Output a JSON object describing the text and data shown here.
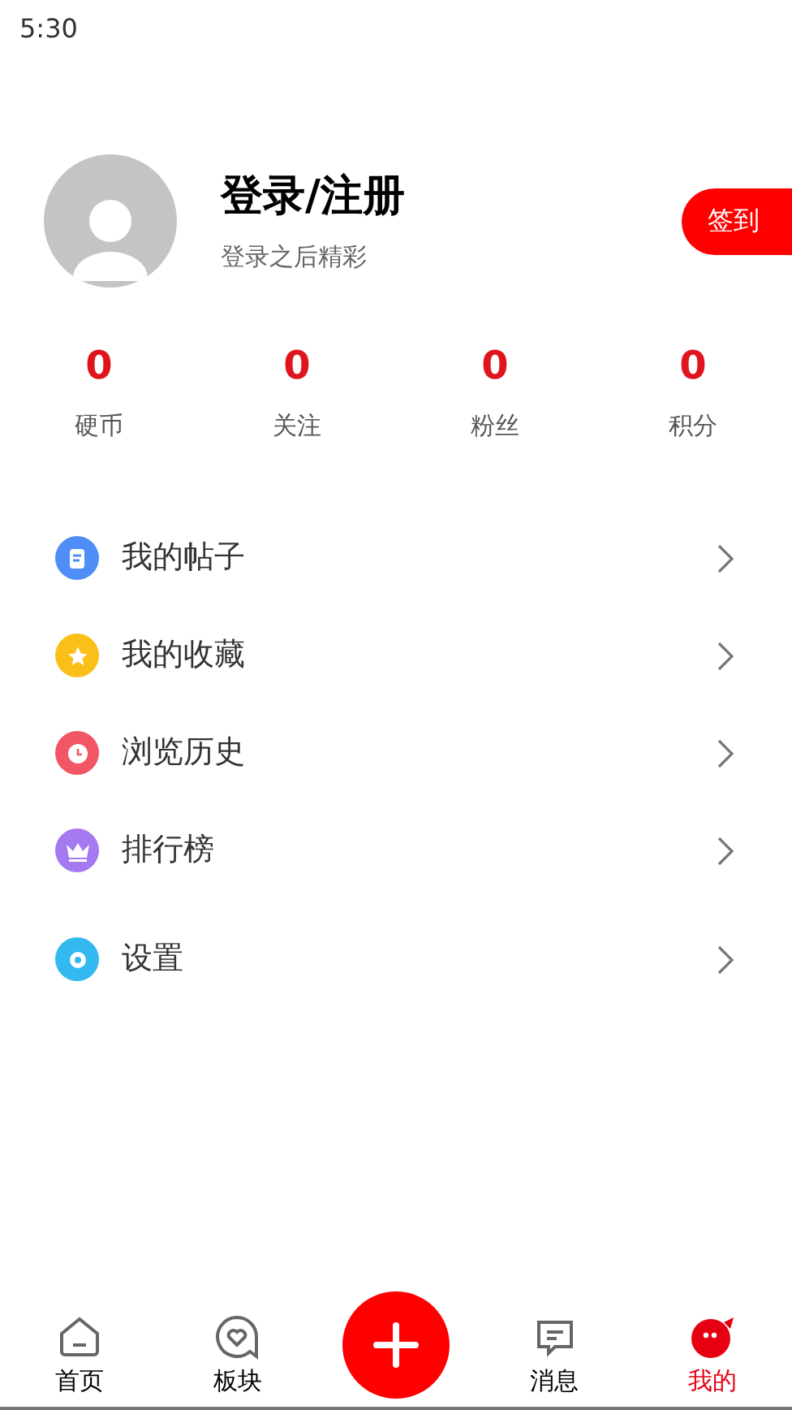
{
  "status_bar": {
    "time": "5:30"
  },
  "profile": {
    "name": "登录/注册",
    "subtitle": "登录之后精彩",
    "checkin_button": "签到"
  },
  "stats": [
    {
      "value": "0",
      "label": "硬币"
    },
    {
      "value": "0",
      "label": "关注"
    },
    {
      "value": "0",
      "label": "粉丝"
    },
    {
      "value": "0",
      "label": "积分"
    }
  ],
  "menu": [
    {
      "label": "我的帖子",
      "kind": "posts",
      "color": "#4f8ef7"
    },
    {
      "label": "我的收藏",
      "kind": "favorites",
      "color": "#fbbf1a"
    },
    {
      "label": "浏览历史",
      "kind": "history",
      "color": "#f25563"
    },
    {
      "label": "排行榜",
      "kind": "ranking",
      "color": "#a57af0"
    },
    {
      "label": "设置",
      "kind": "settings",
      "color": "#33b8f0"
    }
  ],
  "bottom_nav": [
    {
      "kind": "home",
      "label": "首页",
      "selected": false
    },
    {
      "kind": "boards",
      "label": "板块",
      "selected": false
    },
    {
      "kind": "add",
      "selected": false
    },
    {
      "kind": "messages",
      "label": "消息",
      "selected": false
    },
    {
      "kind": "me",
      "label": "我的",
      "selected": true
    }
  ]
}
